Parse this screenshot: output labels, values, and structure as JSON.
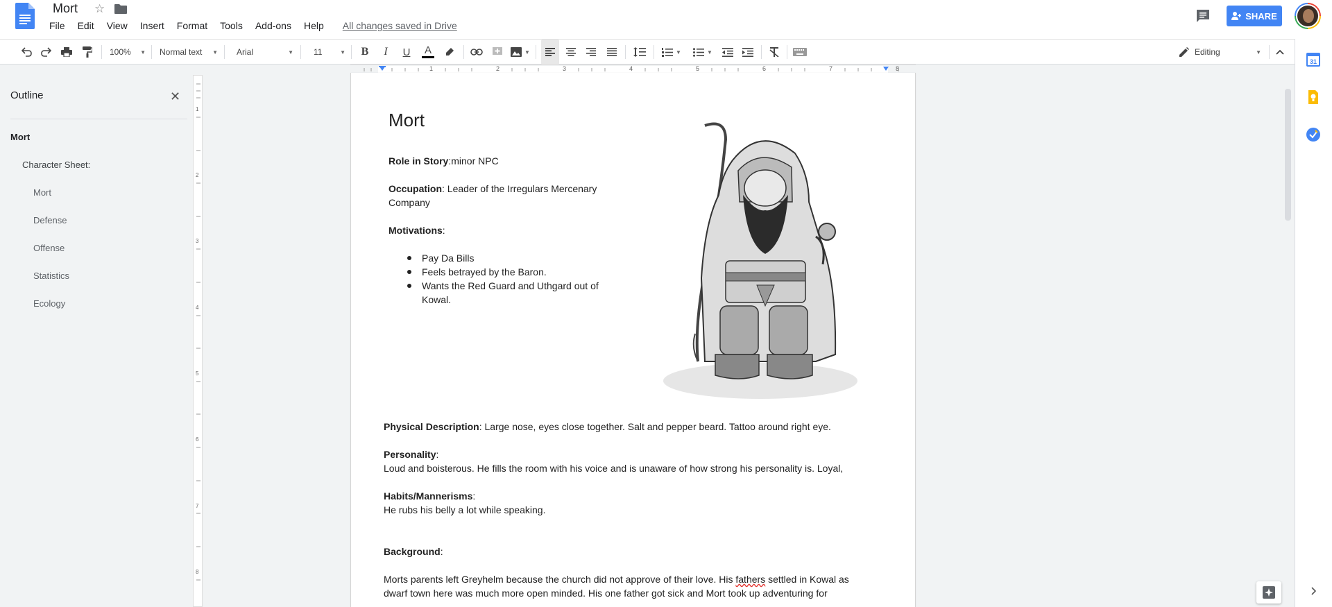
{
  "document": {
    "title": "Mort",
    "save_status": "All changes saved in Drive"
  },
  "menu": [
    "File",
    "Edit",
    "View",
    "Insert",
    "Format",
    "Tools",
    "Add-ons",
    "Help"
  ],
  "header": {
    "share_label": "SHARE"
  },
  "toolbar": {
    "zoom": "100%",
    "style": "Normal text",
    "font": "Arial",
    "size": "11",
    "mode": "Editing"
  },
  "outline": {
    "title": "Outline",
    "items": [
      {
        "label": "Mort",
        "level": 1
      },
      {
        "label": "Character Sheet:",
        "level": 2
      },
      {
        "label": "Mort",
        "level": 3
      },
      {
        "label": "Defense",
        "level": 3
      },
      {
        "label": "Offense",
        "level": 3
      },
      {
        "label": "Statistics",
        "level": 3
      },
      {
        "label": "Ecology",
        "level": 3
      }
    ]
  },
  "ruler": [
    "1",
    "2",
    "3",
    "4",
    "5",
    "6",
    "7",
    "8"
  ],
  "vruler": [
    "1",
    "2",
    "3",
    "4",
    "5",
    "6",
    "7",
    "8"
  ],
  "content": {
    "heading": "Mort",
    "role_label": "Role in Story",
    "role_value": ":minor NPC",
    "occupation_label": "Occupation",
    "occupation_value_1": ": Leader of the Irregulars Mercenary",
    "occupation_value_2": "Company",
    "motivations_label": "Motivations",
    "colon": ":",
    "motivations": [
      "Pay Da Bills",
      "Feels betrayed by the Baron.",
      "Wants the Red Guard and Uthgard out of",
      "Kowal."
    ],
    "physical_label": "Physical Description",
    "physical_value": ": Large nose, eyes close together. Salt and pepper beard. Tattoo around right eye.",
    "personality_label": "Personality",
    "personality_value": "Loud and boisterous. He fills the room with his voice and is unaware of how strong his personality is. Loyal,",
    "habits_label": "Habits/Mannerisms",
    "habits_value": "He rubs his belly a lot while speaking.",
    "background_label": "Background",
    "background_line1_a": "Morts parents left Greyhelm because the church did not approve of their love. His ",
    "background_line1_b": "fathers",
    "background_line1_c": " settled in Kowal as",
    "background_line2": "dwarf town here was much more open minded. His one father got sick and Mort took up adventuring for"
  }
}
